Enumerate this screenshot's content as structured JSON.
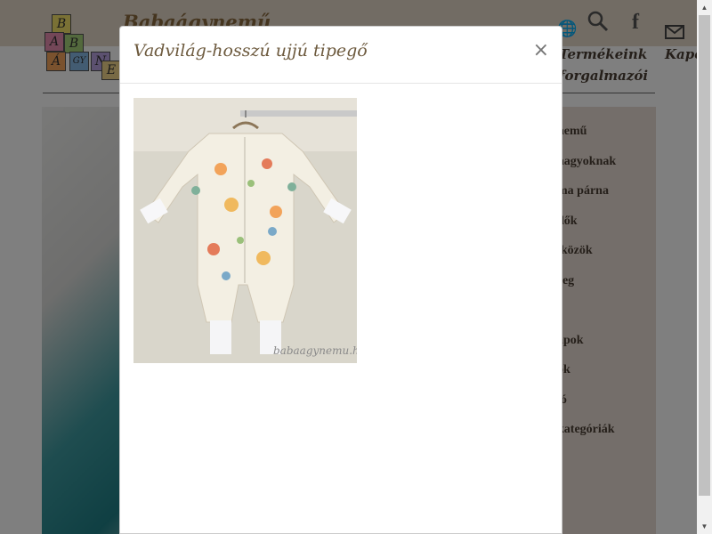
{
  "site": {
    "title": "Babaágynemű",
    "logo_letters": [
      "B",
      "A",
      "B",
      "A",
      "Á",
      "GY",
      "N",
      "E"
    ],
    "nav": {
      "products_line1": "Termékeink",
      "products_line2": "forgalmazói",
      "contact": "Kapc"
    },
    "icons": [
      "globe-icon",
      "search-icon",
      "facebook-icon",
      "mail-icon"
    ]
  },
  "sidebar": {
    "items": [
      "nemű",
      "nagyoknak",
      "ma párna",
      "dők",
      "lközök",
      "reg",
      "apok",
      "ok",
      "ló",
      "kategóriák"
    ]
  },
  "modal": {
    "title": "Vadvilág-hosszú ujjú tipegő",
    "close_label": "×",
    "image_watermark": "babaagynemu.hu"
  },
  "colors": {
    "topbar": "#e4d8c9",
    "accent_text": "#6d5a3e",
    "sidebar_bg": "#e8ddd4"
  }
}
